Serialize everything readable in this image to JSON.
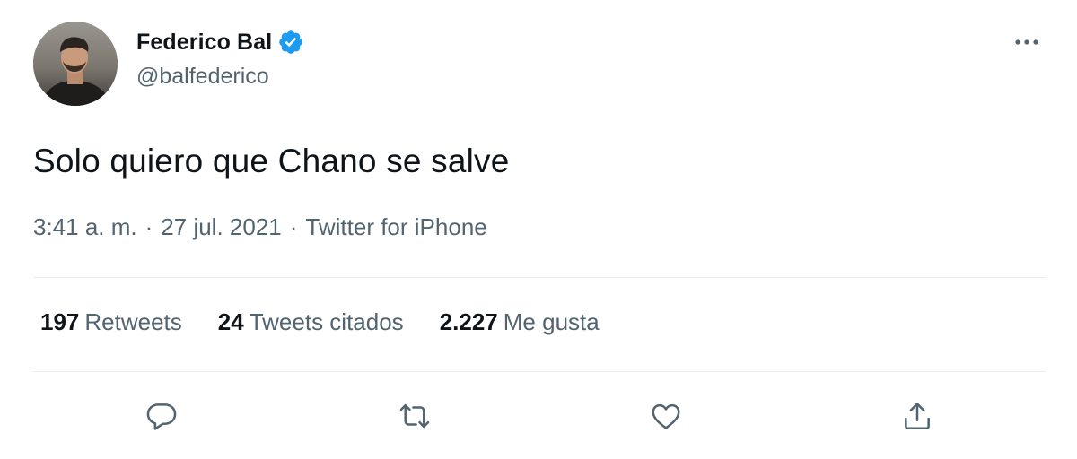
{
  "author": {
    "name": "Federico Bal",
    "handle": "@balfederico",
    "verified_color": "#1d9bf0"
  },
  "tweet": {
    "text": "Solo quiero que Chano se salve",
    "time": "3:41 a. m.",
    "separator": "·",
    "date": "27 jul. 2021",
    "source": "Twitter for iPhone"
  },
  "stats": [
    {
      "count": "197",
      "label": "Retweets"
    },
    {
      "count": "24",
      "label": "Tweets citados"
    },
    {
      "count": "2.227",
      "label": "Me gusta"
    }
  ],
  "actions": [
    "reply-icon",
    "retweet-icon",
    "like-icon",
    "share-icon"
  ],
  "colors": {
    "text": "#0f1419",
    "secondary": "#536471",
    "divider": "#e6ecf0",
    "accent": "#1d9bf0"
  }
}
